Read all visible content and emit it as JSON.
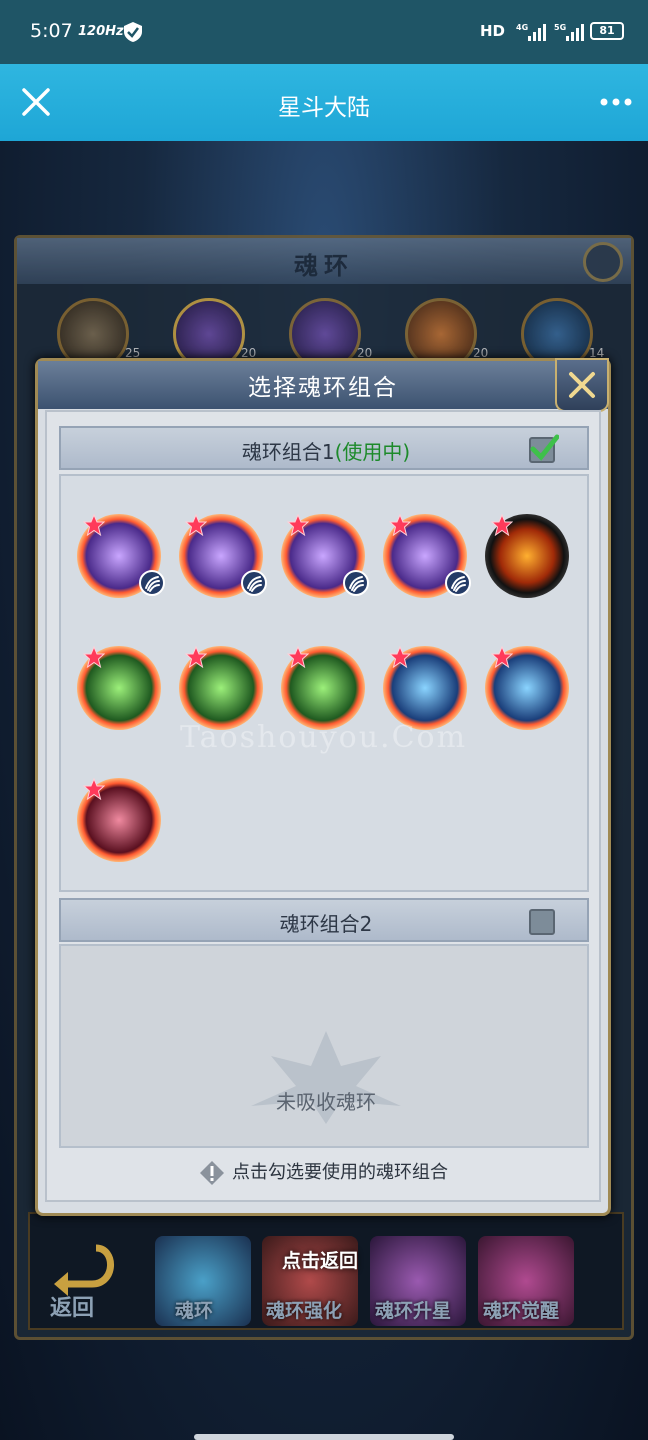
{
  "status_bar": {
    "time": "5:07",
    "refresh_rate": "120Hz",
    "network_hd": "HD",
    "network_4g": "4G",
    "network_5g": "5G",
    "battery": "81"
  },
  "app_bar": {
    "title": "星斗大陆"
  },
  "background_panel": {
    "title": "魂环",
    "levels": [
      "25",
      "20",
      "20",
      "20",
      "14"
    ]
  },
  "modal": {
    "title": "选择魂环组合",
    "group1": {
      "title": "魂环组合1",
      "status": "(使用中)",
      "checked": true
    },
    "group2": {
      "title": "魂环组合2",
      "checked": false,
      "empty_text": "未吸收魂环"
    },
    "hint": "点击勾选要使用的魂环组合"
  },
  "rings": [
    {
      "icon": "purple-beast-ring-icon",
      "has_badge": true
    },
    {
      "icon": "purple-beast-ring-icon",
      "has_badge": true
    },
    {
      "icon": "purple-lightning-ring-icon",
      "has_badge": true
    },
    {
      "icon": "purple-beast-ring-icon",
      "has_badge": true
    },
    {
      "icon": "fire-ring-icon",
      "has_badge": false
    },
    {
      "icon": "green-sprout-ring-icon",
      "has_badge": false
    },
    {
      "icon": "green-clover-ring-icon",
      "has_badge": false
    },
    {
      "icon": "green-spirit-ring-icon",
      "has_badge": false
    },
    {
      "icon": "blue-ice-ring-icon",
      "has_badge": false
    },
    {
      "icon": "blue-claw-ring-icon",
      "has_badge": false
    },
    {
      "icon": "red-beast-ring-icon",
      "has_badge": false
    }
  ],
  "bottom_tabs": {
    "back": "返回",
    "tip": "点击返回",
    "items": [
      "魂环",
      "魂环强化",
      "魂环升星",
      "魂环觉醒"
    ]
  },
  "watermark": "Taoshouyou.Com",
  "colors": {
    "app_bar": "#22aad9",
    "in_use": "#1d8a2a",
    "ring_glow": "#ff5a30"
  }
}
